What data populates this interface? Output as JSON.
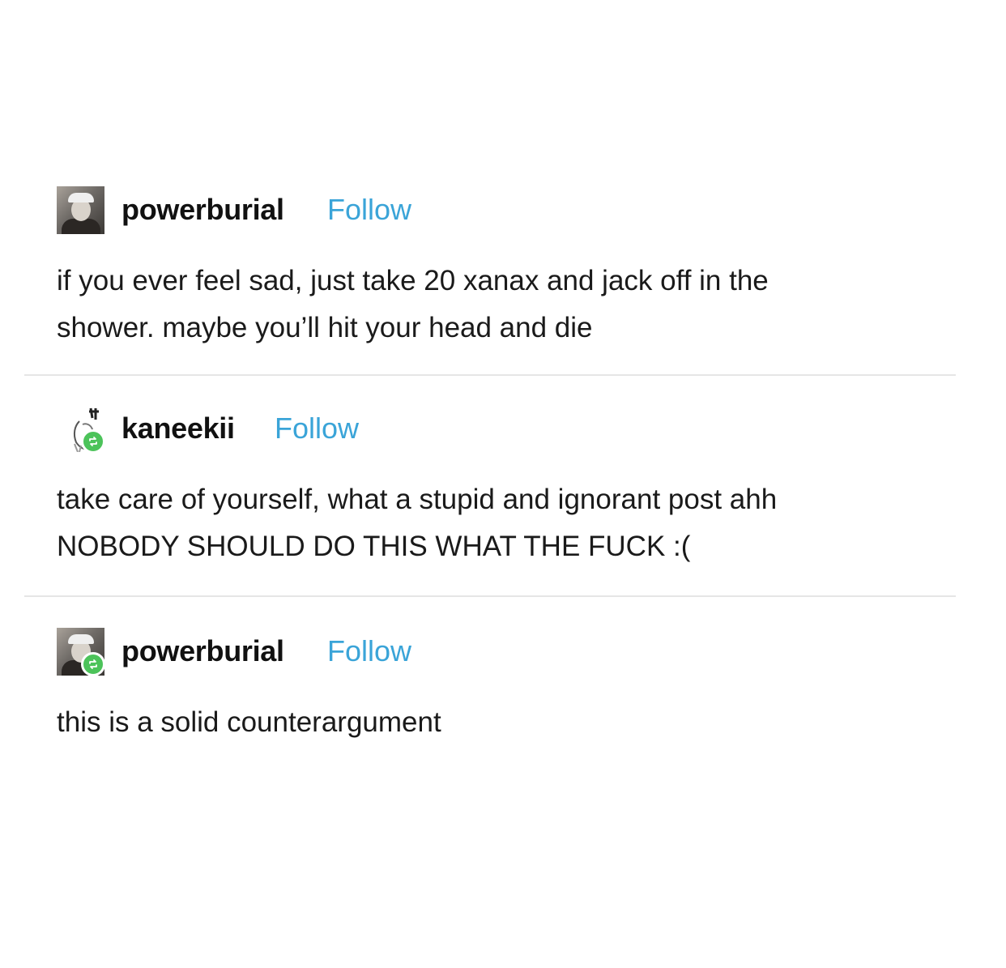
{
  "colors": {
    "background": "#ffffff",
    "text": "#1a1a1a",
    "follow_link": "#3aa4d8",
    "reblog_badge": "#4cc35a",
    "divider": "#e6e6e6"
  },
  "posts": [
    {
      "username": "powerburial",
      "follow_label": "Follow",
      "avatar_icon": "user-photo-avatar",
      "reblog": false,
      "lines": [
        "if you ever feel sad, just take 20 xanax and jack off in the",
        "shower. maybe you’ll hit your head and die"
      ]
    },
    {
      "username": "kaneekii",
      "follow_label": "Follow",
      "avatar_icon": "user-sketch-avatar",
      "reblog": true,
      "reblog_icon": "reblog-icon",
      "lines": [
        "take care of yourself, what a stupid and ignorant post ahh",
        "NOBODY SHOULD DO THIS WHAT THE FUCK :("
      ]
    },
    {
      "username": "powerburial",
      "follow_label": "Follow",
      "avatar_icon": "user-photo-avatar",
      "reblog": true,
      "reblog_icon": "reblog-icon",
      "lines": [
        "this is a solid counterargument"
      ]
    }
  ]
}
